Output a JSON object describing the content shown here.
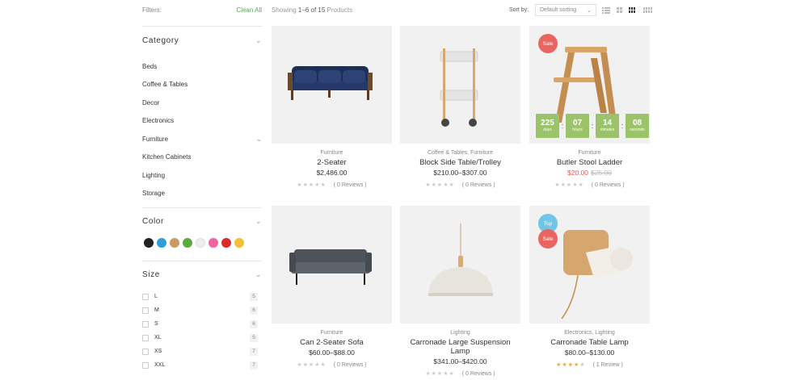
{
  "sidebar": {
    "filters_title": "Filters:",
    "clear_all": "Clean All",
    "category_title": "Category",
    "categories": [
      {
        "label": "Beds",
        "expandable": false
      },
      {
        "label": "Coffee & Tables",
        "expandable": false
      },
      {
        "label": "Decor",
        "expandable": false
      },
      {
        "label": "Electronics",
        "expandable": false
      },
      {
        "label": "Furniture",
        "expandable": true
      },
      {
        "label": "Kitchen Cabinets",
        "expandable": false
      },
      {
        "label": "Lighting",
        "expandable": false
      },
      {
        "label": "Storage",
        "expandable": false
      }
    ],
    "color_title": "Color",
    "colors": [
      "#222222",
      "#2d9ed8",
      "#c99a62",
      "#5da93d",
      "#eeeeee",
      "#ef66a0",
      "#d92b2b",
      "#f4bd3a"
    ],
    "size_title": "Size",
    "sizes": [
      {
        "label": "L",
        "count": "5"
      },
      {
        "label": "M",
        "count": "6"
      },
      {
        "label": "S",
        "count": "6"
      },
      {
        "label": "XL",
        "count": "5"
      },
      {
        "label": "XS",
        "count": "7"
      },
      {
        "label": "XXL",
        "count": "7"
      }
    ]
  },
  "toolbar": {
    "showing_prefix": "Showing",
    "showing_range": "1–6 of 15",
    "showing_suffix": "Products",
    "sort_label": "Sort by:",
    "sort_value": "Default sorting"
  },
  "products": [
    {
      "category": "Furniture",
      "name": "2-Seater",
      "price": "$2,486.00",
      "reviews": "( 0 Reviews )",
      "stars": 0
    },
    {
      "category": "Coffee & Tables, Furniture",
      "name": "Block Side Table/Trolley",
      "price": "$210.00–$307.00",
      "reviews": "( 0 Reviews )",
      "stars": 0
    },
    {
      "category": "Furniture",
      "name": "Butler Stool Ladder",
      "sale_price": "$20.00",
      "old_price": "$25.00",
      "reviews": "( 0 Reviews )",
      "stars": 0,
      "badge": "Sale",
      "countdown": [
        {
          "num": "225",
          "lbl": "days"
        },
        {
          "num": "07",
          "lbl": "hours"
        },
        {
          "num": "14",
          "lbl": "minutes"
        },
        {
          "num": "08",
          "lbl": "seconds"
        }
      ]
    },
    {
      "category": "Furniture",
      "name": "Can 2-Seater Sofa",
      "price": "$60.00–$88.00",
      "reviews": "( 0 Reviews )",
      "stars": 0
    },
    {
      "category": "Lighting",
      "name": "Carronade Large Suspension Lamp",
      "price": "$341.00–$420.00",
      "reviews": "( 0 Reviews )",
      "stars": 0
    },
    {
      "category": "Electronics, Lighting",
      "name": "Carronade Table Lamp",
      "price": "$80.00–$130.00",
      "reviews": "( 1 Review )",
      "stars": 4,
      "badge_top": "Top",
      "badge": "Sale"
    }
  ]
}
